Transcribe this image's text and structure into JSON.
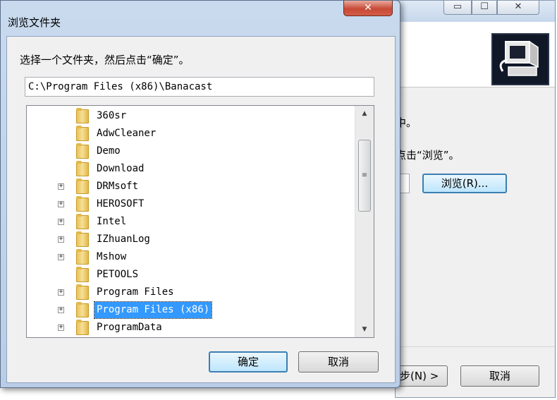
{
  "background_window": {
    "minimize_glyph": "▭",
    "maximize_glyph": "☐",
    "close_glyph": "✕",
    "line1": "中。",
    "line2": "点击“浏览”。",
    "browse_label": "浏览(R)...",
    "next_label": "步(N) >",
    "cancel_label": "取消"
  },
  "dialog": {
    "title": "浏览文件夹",
    "close_glyph": "✕",
    "prompt": "选择一个文件夹，然后点击“确定”。",
    "path_value": "C:\\Program Files (x86)\\Banacast",
    "ok_label": "确定",
    "cancel_label": "取消",
    "tree_items": [
      {
        "label": "360sr",
        "expandable": false,
        "selected": false
      },
      {
        "label": "AdwCleaner",
        "expandable": false,
        "selected": false
      },
      {
        "label": "Demo",
        "expandable": false,
        "selected": false
      },
      {
        "label": "Download",
        "expandable": false,
        "selected": false
      },
      {
        "label": "DRMsoft",
        "expandable": true,
        "selected": false
      },
      {
        "label": "HEROSOFT",
        "expandable": true,
        "selected": false
      },
      {
        "label": "Intel",
        "expandable": true,
        "selected": false
      },
      {
        "label": "IZhuanLog",
        "expandable": true,
        "selected": false
      },
      {
        "label": "Mshow",
        "expandable": true,
        "selected": false
      },
      {
        "label": "PETOOLS",
        "expandable": false,
        "selected": false
      },
      {
        "label": "Program Files",
        "expandable": true,
        "selected": false
      },
      {
        "label": "Program Files (x86)",
        "expandable": true,
        "selected": true
      },
      {
        "label": "ProgramData",
        "expandable": true,
        "selected": false
      }
    ],
    "expander_glyph": "+",
    "scroll_up_glyph": "▲",
    "scroll_down_glyph": "▼",
    "scroll_grip_glyph": "≡"
  }
}
